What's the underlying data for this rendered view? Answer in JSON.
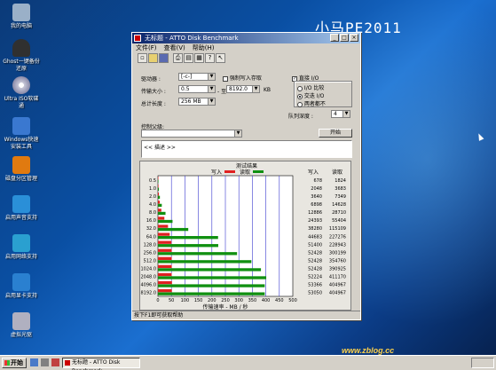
{
  "desktop": {
    "brand": "小马PE2011",
    "watermark": "www.zblog.cc",
    "icons": [
      {
        "label": "我的电脑",
        "icon": "computer-icon",
        "color": "#9ab0c8"
      },
      {
        "label": "Ghost一键备份还原",
        "icon": "ghost-icon",
        "color": "#303030"
      },
      {
        "label": "Ultra ISO软碟通",
        "icon": "disc-icon",
        "color": "#c9c9d9"
      },
      {
        "label": "Windows快速安装工具",
        "icon": "install-icon",
        "color": "#3a78d0"
      },
      {
        "label": "磁盘分区管理",
        "icon": "partition-icon",
        "color": "#e07a10"
      },
      {
        "label": "启用声音支持",
        "icon": "speaker-icon",
        "color": "#2a8fd8"
      },
      {
        "label": "启用网络支持",
        "icon": "network-icon",
        "color": "#2aa0d0"
      },
      {
        "label": "启用显卡支持",
        "icon": "display-icon",
        "color": "#2a80d0"
      },
      {
        "label": "虚拟光驱",
        "icon": "virtual-drive-icon",
        "color": "#b0b0c0"
      }
    ]
  },
  "window": {
    "title": "无标题 - ATTO Disk Benchmark",
    "menu": [
      "文件(F)",
      "查看(V)",
      "帮助(H)"
    ],
    "toolbar_icons": [
      "new-icon",
      "open-icon",
      "save-icon",
      "print-icon",
      "preview-icon",
      "sheet-icon",
      "help-icon",
      "context-help-icon"
    ],
    "drive_label": "驱动器 :",
    "drive_value": "[-c-]",
    "force_write_label": "强制写入存取",
    "direct_io_label": "直接 I/O",
    "transfer_label": "传输大小 :",
    "transfer_from": "0.5",
    "transfer_to_sep": "- 至",
    "transfer_to": "8192.0",
    "transfer_unit": "KB",
    "total_label": "总计长度 :",
    "total_value": "256 MB",
    "radio_options": [
      {
        "label": "I/O 比较",
        "checked": false
      },
      {
        "label": "交迭 I/O",
        "checked": true
      },
      {
        "label": "两者都不",
        "checked": false
      }
    ],
    "queue_label": "队列深度 :",
    "queue_value": "4",
    "controlled_by_label": "控制父级:",
    "start_button": "开始",
    "description": "<< 描述 >>",
    "status": "按下F1即可获取帮助"
  },
  "chart_data": {
    "type": "bar",
    "title": "测试结果",
    "xlabel": "传输速率 - MB / 秒",
    "xlim": [
      0,
      500
    ],
    "x_ticks": [
      "0",
      "50",
      "100",
      "150",
      "200",
      "250",
      "300",
      "350",
      "400",
      "450",
      "500"
    ],
    "categories": [
      "0.5",
      "1.0",
      "2.0",
      "4.0",
      "8.0",
      "16.0",
      "32.0",
      "64.0",
      "128.0",
      "256.0",
      "512.0",
      "1024.0",
      "2048.0",
      "4096.0",
      "8192.0"
    ],
    "col_write_header": "写入",
    "col_read_header": "读取",
    "series": [
      {
        "name": "写入",
        "color": "#e02020",
        "values": [
          0.66,
          2.0,
          3.55,
          6.74,
          12.58,
          23.82,
          37.38,
          43.63,
          50.2,
          51.2,
          51.2,
          51.2,
          50.99,
          52.11,
          51.81
        ]
      },
      {
        "name": "读取",
        "color": "#109010",
        "values": [
          1.78,
          3.6,
          7.18,
          14.28,
          28.04,
          54.11,
          112.41,
          222.92,
          223.61,
          293.22,
          346.45,
          381.86,
          401.53,
          395.96,
          395.96
        ]
      }
    ],
    "write_values": [
      "678",
      "2048",
      "3640",
      "6898",
      "12886",
      "24393",
      "38280",
      "44683",
      "51400",
      "52428",
      "52428",
      "52428",
      "52224",
      "53366",
      "53050"
    ],
    "read_values": [
      "1824",
      "3683",
      "7349",
      "14628",
      "28710",
      "55404",
      "115109",
      "227276",
      "228943",
      "300199",
      "354760",
      "390925",
      "411170",
      "404967",
      "404967"
    ]
  }
}
